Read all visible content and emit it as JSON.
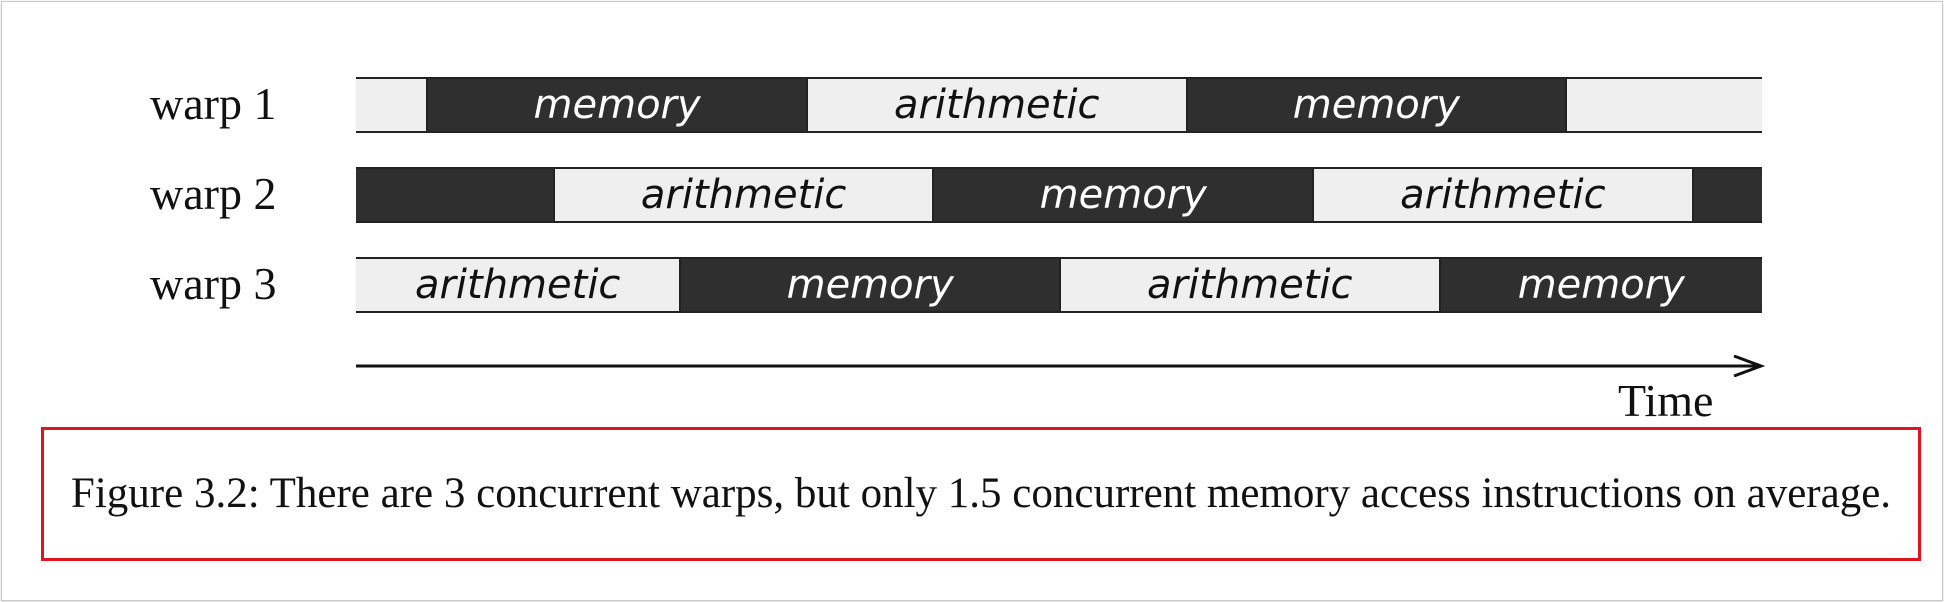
{
  "diagram": {
    "time_unit": "",
    "warps": [
      {
        "label": "warp 1",
        "segments": [
          {
            "kind": "idle",
            "text": "",
            "start": 0,
            "end": 0.5
          },
          {
            "kind": "memory",
            "text": "memory",
            "start": 0.5,
            "end": 3.2
          },
          {
            "kind": "arithmetic",
            "text": "arithmetic",
            "start": 3.2,
            "end": 5.9
          },
          {
            "kind": "memory",
            "text": "memory",
            "start": 5.9,
            "end": 8.6
          },
          {
            "kind": "idle",
            "text": "",
            "start": 8.6,
            "end": 10
          }
        ]
      },
      {
        "label": "warp 2",
        "segments": [
          {
            "kind": "memory",
            "text": "",
            "start": 0,
            "end": 1.4
          },
          {
            "kind": "arithmetic",
            "text": "arithmetic",
            "start": 1.4,
            "end": 4.1
          },
          {
            "kind": "memory",
            "text": "memory",
            "start": 4.1,
            "end": 6.8
          },
          {
            "kind": "arithmetic",
            "text": "arithmetic",
            "start": 6.8,
            "end": 9.5
          },
          {
            "kind": "memory",
            "text": "",
            "start": 9.5,
            "end": 10
          }
        ]
      },
      {
        "label": "warp 3",
        "segments": [
          {
            "kind": "arithmetic",
            "text": "arithmetic",
            "start": 0,
            "end": 2.3
          },
          {
            "kind": "memory",
            "text": "memory",
            "start": 2.3,
            "end": 5.0
          },
          {
            "kind": "arithmetic",
            "text": "arithmetic",
            "start": 5.0,
            "end": 7.7
          },
          {
            "kind": "memory",
            "text": "memory",
            "start": 7.7,
            "end": 10
          }
        ]
      }
    ],
    "axis_label": "Time"
  },
  "caption": "Figure 3.2: There are 3 concurrent warps, but only 1.5 concurrent memory access instructions on average.",
  "colors": {
    "memory": "#2f2f2f",
    "arithmetic": "#efefef",
    "highlight_border": "#e0141e"
  }
}
